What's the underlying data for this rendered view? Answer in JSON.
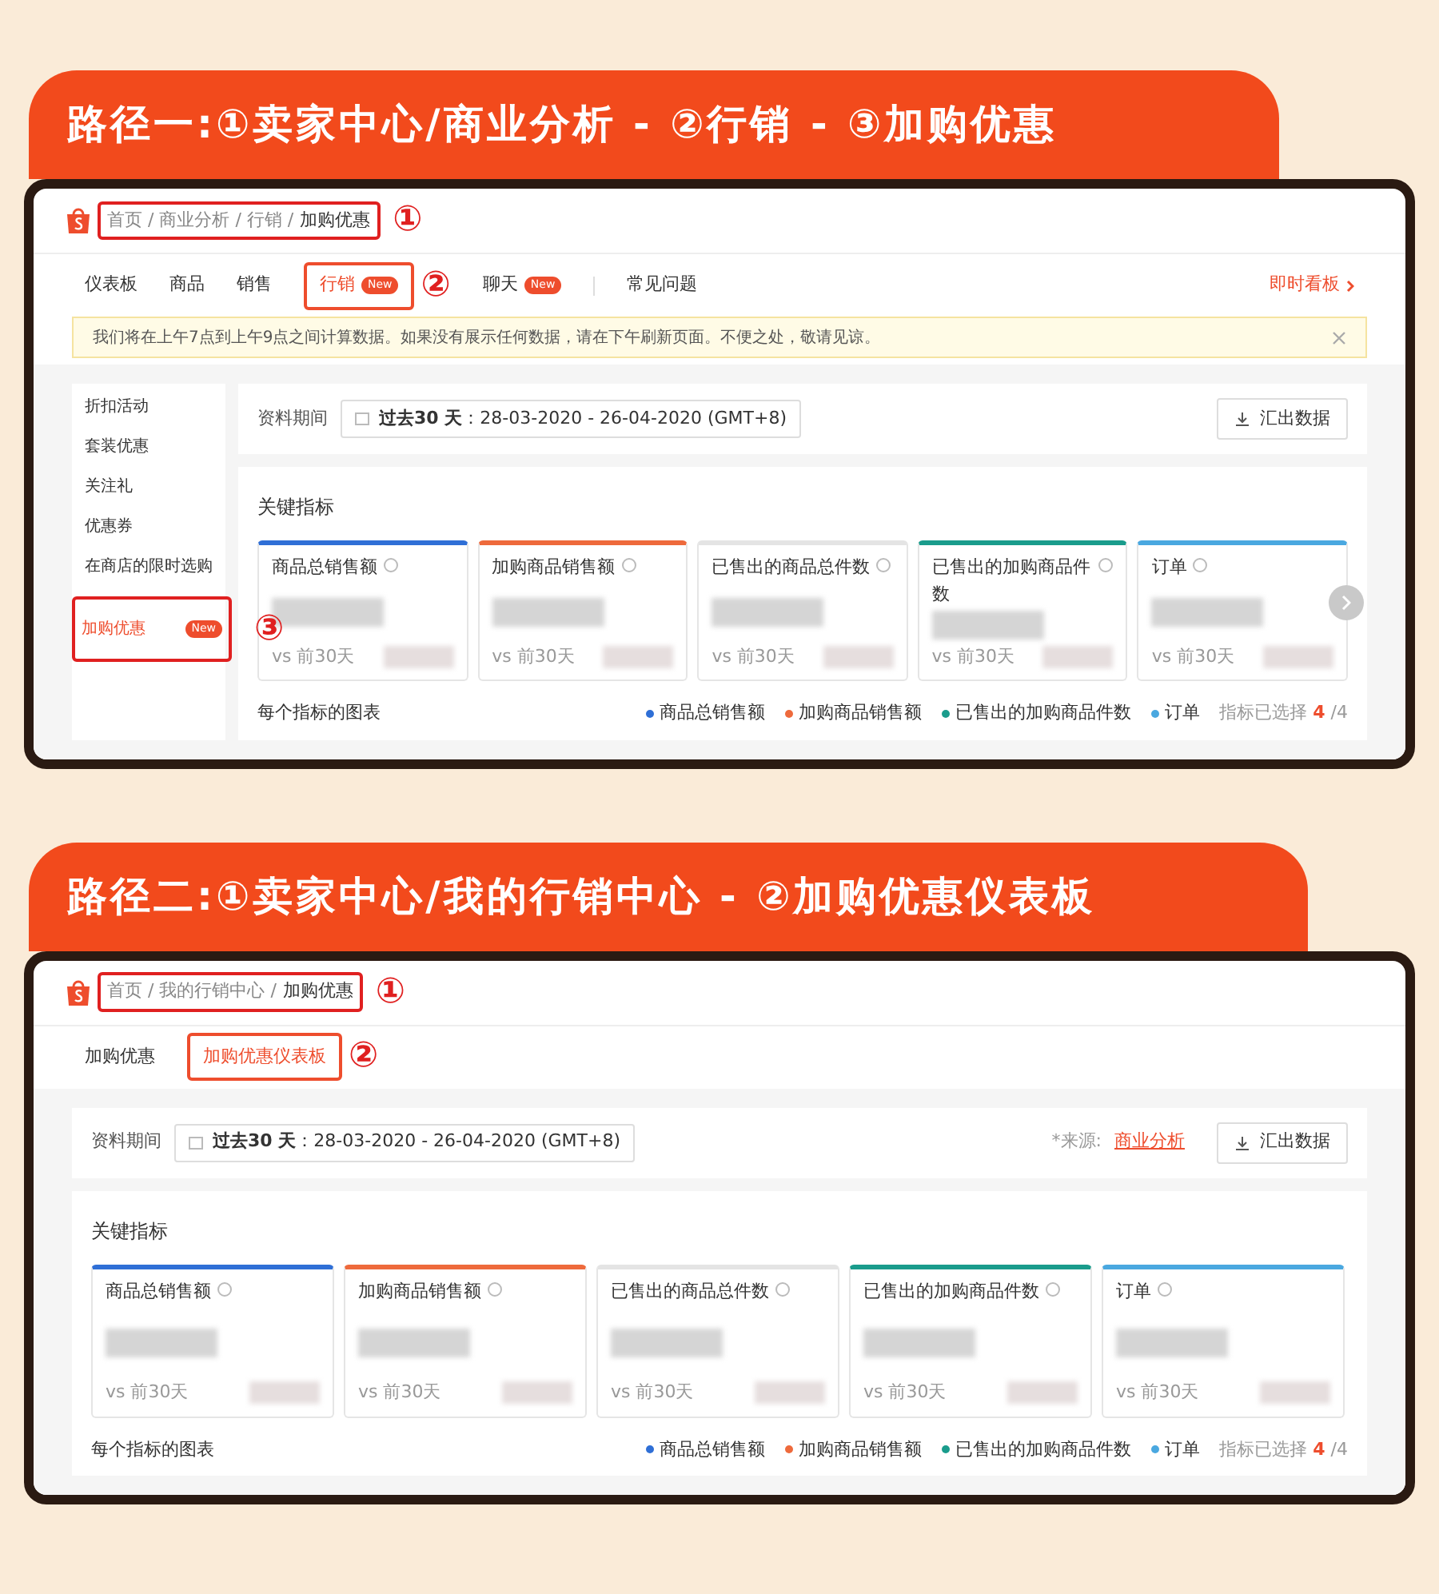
{
  "sections": [
    {
      "title": "路径一:①卖家中心/商业分析 - ②行销 - ③加购优惠",
      "breadcrumb": {
        "path": "首页 / 商业分析 / 行销 /",
        "current": "加购优惠",
        "callout": "①"
      },
      "tabs": [
        {
          "label": "仪表板",
          "selected": false
        },
        {
          "label": "商品",
          "selected": false
        },
        {
          "label": "销售",
          "selected": false
        },
        {
          "label": "行销",
          "selected": true,
          "badge": "New",
          "callout": "②"
        },
        {
          "label": "聊天",
          "selected": false,
          "badge": "New"
        },
        {
          "kind": "divider"
        },
        {
          "label": "常见问题",
          "selected": false
        }
      ],
      "right_link": "即时看板",
      "notice": "我们将在上午7点到上午9点之间计算数据。如果没有展示任何数据，请在下午刷新页面。不便之处，敬请见谅。",
      "sidebar": [
        {
          "label": "折扣活动",
          "selected": false
        },
        {
          "label": "套装优惠",
          "selected": false
        },
        {
          "label": "关注礼",
          "selected": false
        },
        {
          "label": "优惠券",
          "selected": false
        },
        {
          "label": "在商店的限时选购",
          "selected": false
        },
        {
          "label": "加购优惠",
          "selected": true,
          "badge": "New",
          "callout": "③"
        }
      ],
      "period_label": "资料期间",
      "period": "**过去30 天**：28-03-2020 - 26-04-2020 (GMT+8)",
      "export": "汇出数据",
      "metrics_title": "关键指标",
      "cards": [
        {
          "title": "商品总销售额",
          "color": "#2f6fd6",
          "compare": "vs 前30天"
        },
        {
          "title": "加购商品销售额",
          "color": "#ee6a3c",
          "compare": "vs 前30天"
        },
        {
          "title": "已售出的商品总件数",
          "color": "#e4e4e4",
          "compare": "vs 前30天"
        },
        {
          "title": "已售出的加购商品件数",
          "color": "#1a9c8c",
          "compare": "vs 前30天"
        },
        {
          "title": "订单",
          "color": "#4aa8e0",
          "compare": "vs 前30天"
        }
      ],
      "next_button": true,
      "chart_title": "每个指标的图表",
      "legend": [
        {
          "label": "商品总销售额",
          "color": "#2f6fd6"
        },
        {
          "label": "加购商品销售额",
          "color": "#ee6a3c"
        },
        {
          "label": "已售出的加购商品件数",
          "color": "#1a9c8c"
        },
        {
          "label": "订单",
          "color": "#4aa8e0"
        }
      ],
      "selected_label": "指标已选择",
      "selected_count": "4",
      "selected_total": "/4"
    },
    {
      "title": "路径二:①卖家中心/我的行销中心 - ②加购优惠仪表板",
      "breadcrumb": {
        "path": "首页 / 我的行销中心 /",
        "current": "加购优惠",
        "callout": "①"
      },
      "tabs": [
        {
          "label": "加购优惠",
          "selected": false
        },
        {
          "label": "加购优惠仪表板",
          "selected": true,
          "callout": "②"
        }
      ],
      "period_label": "资料期间",
      "period": "**过去30 天**：28-03-2020 - 26-04-2020 (GMT+8)",
      "source_label": "*来源:",
      "source_link": "商业分析",
      "export": "汇出数据",
      "metrics_title": "关键指标",
      "cards": [
        {
          "title": "商品总销售额",
          "color": "#2f6fd6",
          "compare": "vs 前30天"
        },
        {
          "title": "加购商品销售额",
          "color": "#ee6a3c",
          "compare": "vs 前30天"
        },
        {
          "title": "已售出的商品总件数",
          "color": "#e4e4e4",
          "compare": "vs 前30天"
        },
        {
          "title": "已售出的加购商品件数",
          "color": "#1a9c8c",
          "compare": "vs 前30天"
        },
        {
          "title": "订单",
          "color": "#4aa8e0",
          "compare": "vs 前30天"
        }
      ],
      "chart_title": "每个指标的图表",
      "legend": [
        {
          "label": "商品总销售额",
          "color": "#2f6fd6"
        },
        {
          "label": "加购商品销售额",
          "color": "#ee6a3c"
        },
        {
          "label": "已售出的加购商品件数",
          "color": "#1a9c8c"
        },
        {
          "label": "订单",
          "color": "#4aa8e0"
        }
      ],
      "selected_label": "指标已选择",
      "selected_count": "4",
      "selected_total": "/4"
    }
  ]
}
